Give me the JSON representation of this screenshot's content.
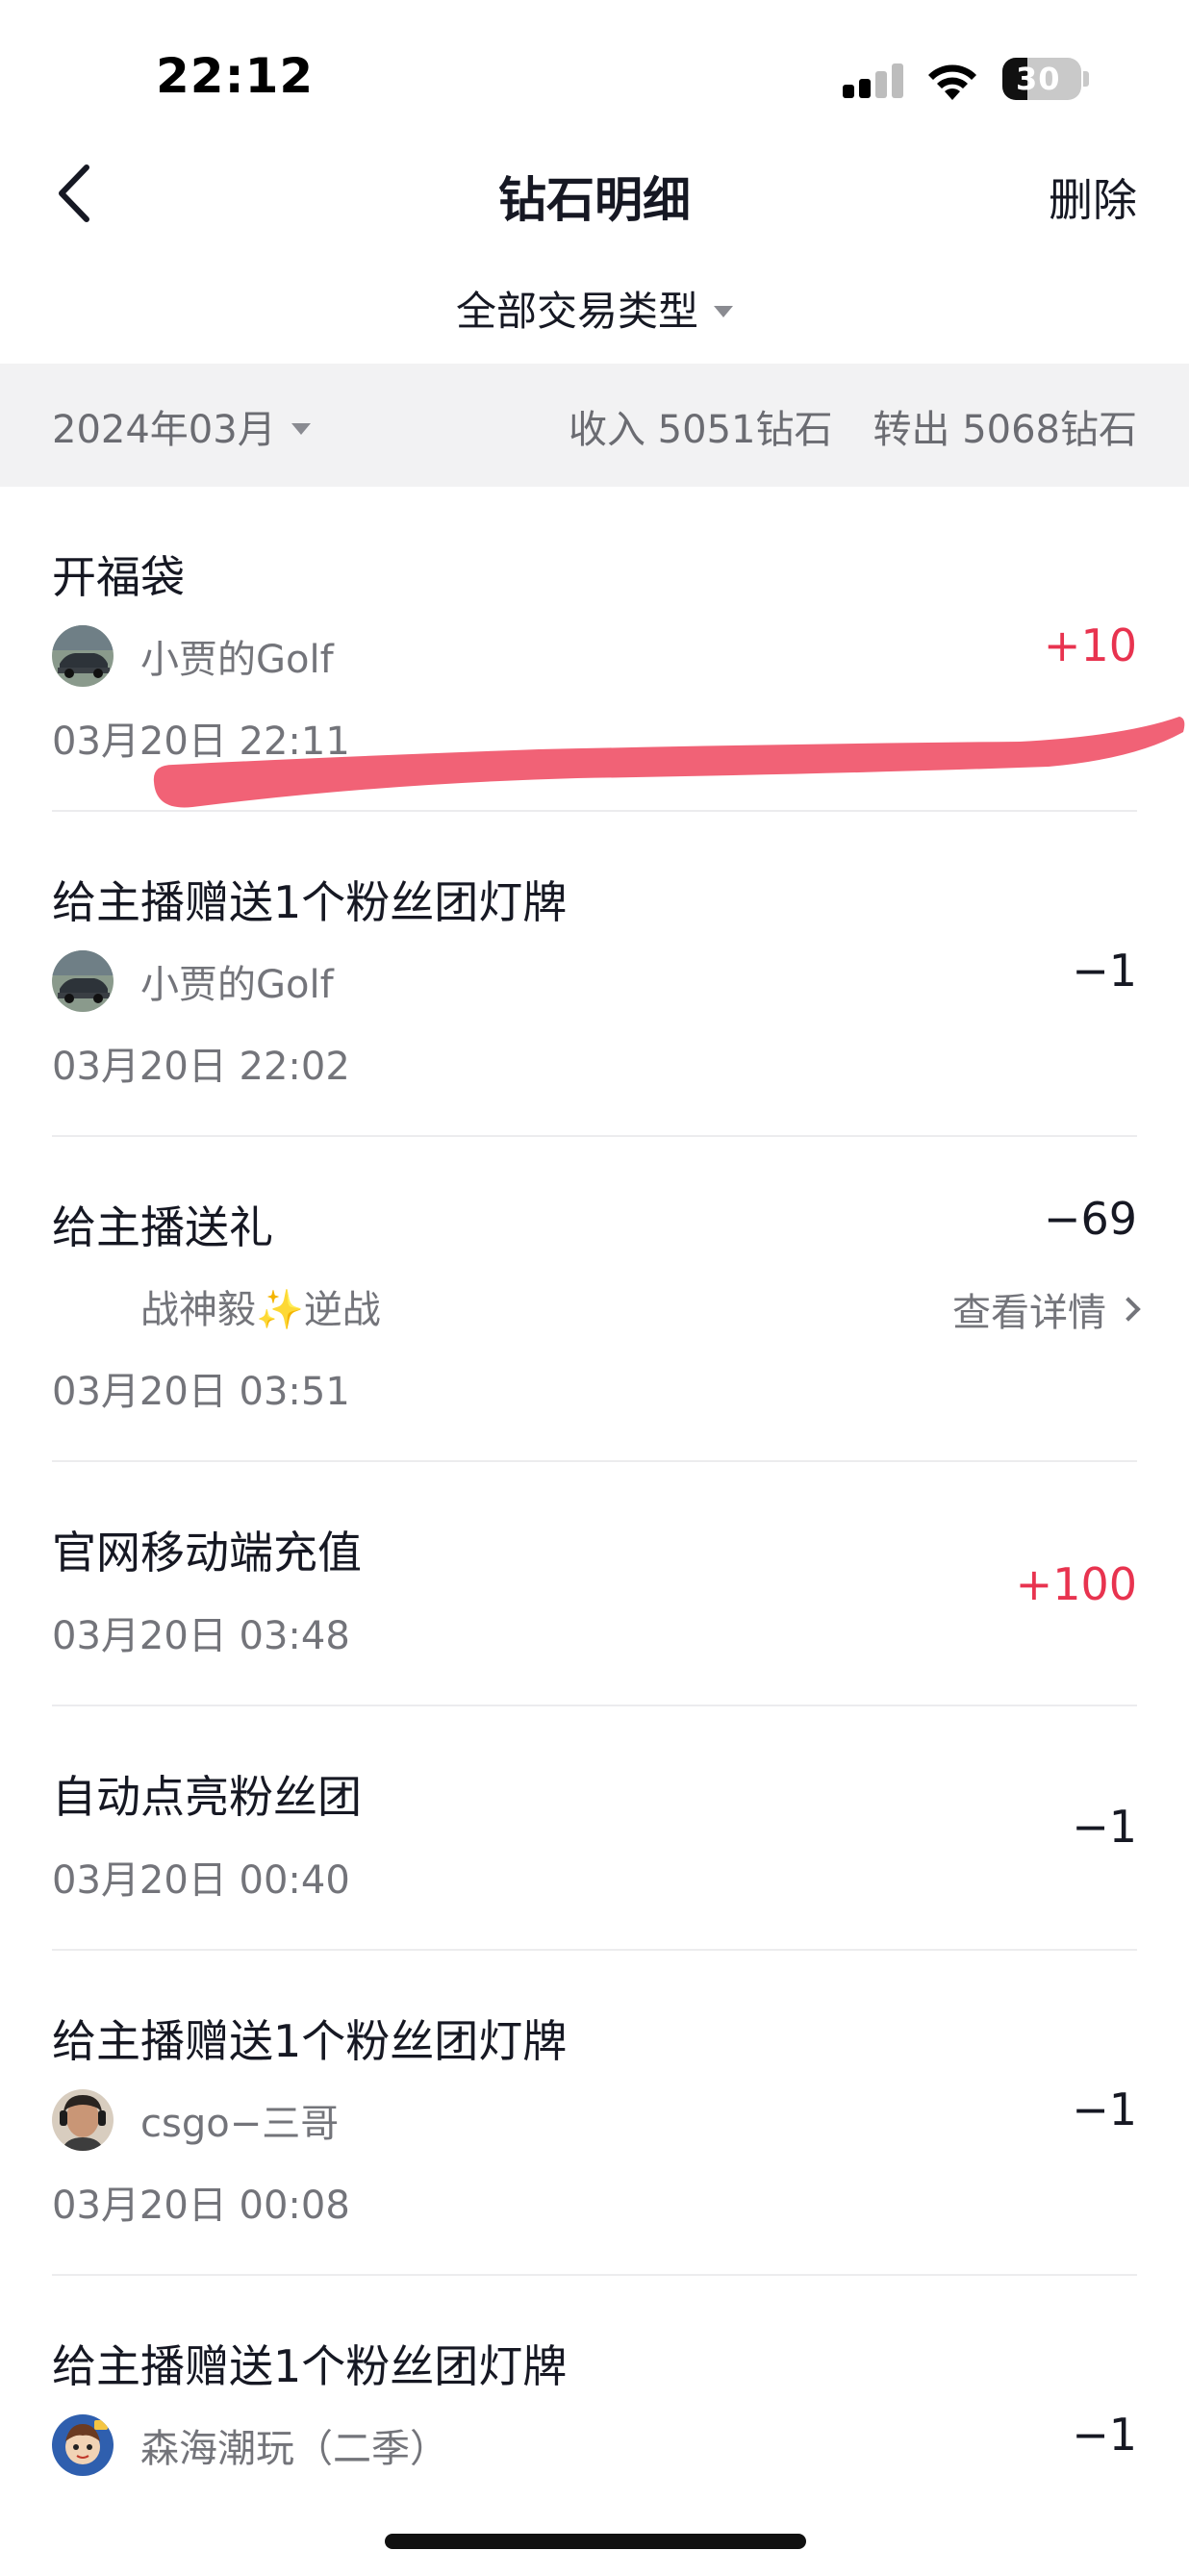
{
  "status_bar": {
    "time": "22:12",
    "battery": "30"
  },
  "header": {
    "title": "钻石明细",
    "delete_label": "删除"
  },
  "filter": {
    "label": "全部交易类型"
  },
  "summary": {
    "month": "2024年03月",
    "income": "收入 5051钻石",
    "outgo": "转出 5068钻石"
  },
  "transactions": [
    {
      "title": "开福袋",
      "user": "小贾的Golf",
      "avatar": "car-photo-avatar",
      "time": "03月20日 22:11",
      "amount": "+10"
    },
    {
      "title": "给主播赠送1个粉丝团灯牌",
      "user": "小贾的Golf",
      "avatar": "car-photo-avatar",
      "time": "03月20日 22:02",
      "amount": "−1"
    },
    {
      "title": "给主播送礼",
      "user": "战神毅✨逆战",
      "avatar": "",
      "time": "03月20日 03:51",
      "amount": "−69",
      "detail": "查看详情"
    },
    {
      "title": "官网移动端充值",
      "time": "03月20日 03:48",
      "amount": "+100"
    },
    {
      "title": "自动点亮粉丝团",
      "time": "03月20日 00:40",
      "amount": "−1"
    },
    {
      "title": "给主播赠送1个粉丝团灯牌",
      "user": "csgo−三哥",
      "avatar": "person-photo-avatar",
      "time": "03月20日 00:08",
      "amount": "−1"
    },
    {
      "title": "给主播赠送1个粉丝团灯牌",
      "user": "森海潮玩（二季）",
      "avatar": "cartoon-avatar",
      "amount": "−1"
    }
  ],
  "colors": {
    "positive": "#e8334f",
    "text": "#161823",
    "secondary": "#73747a",
    "summary_bg": "#f2f2f3",
    "scribble": "#f0556a"
  }
}
